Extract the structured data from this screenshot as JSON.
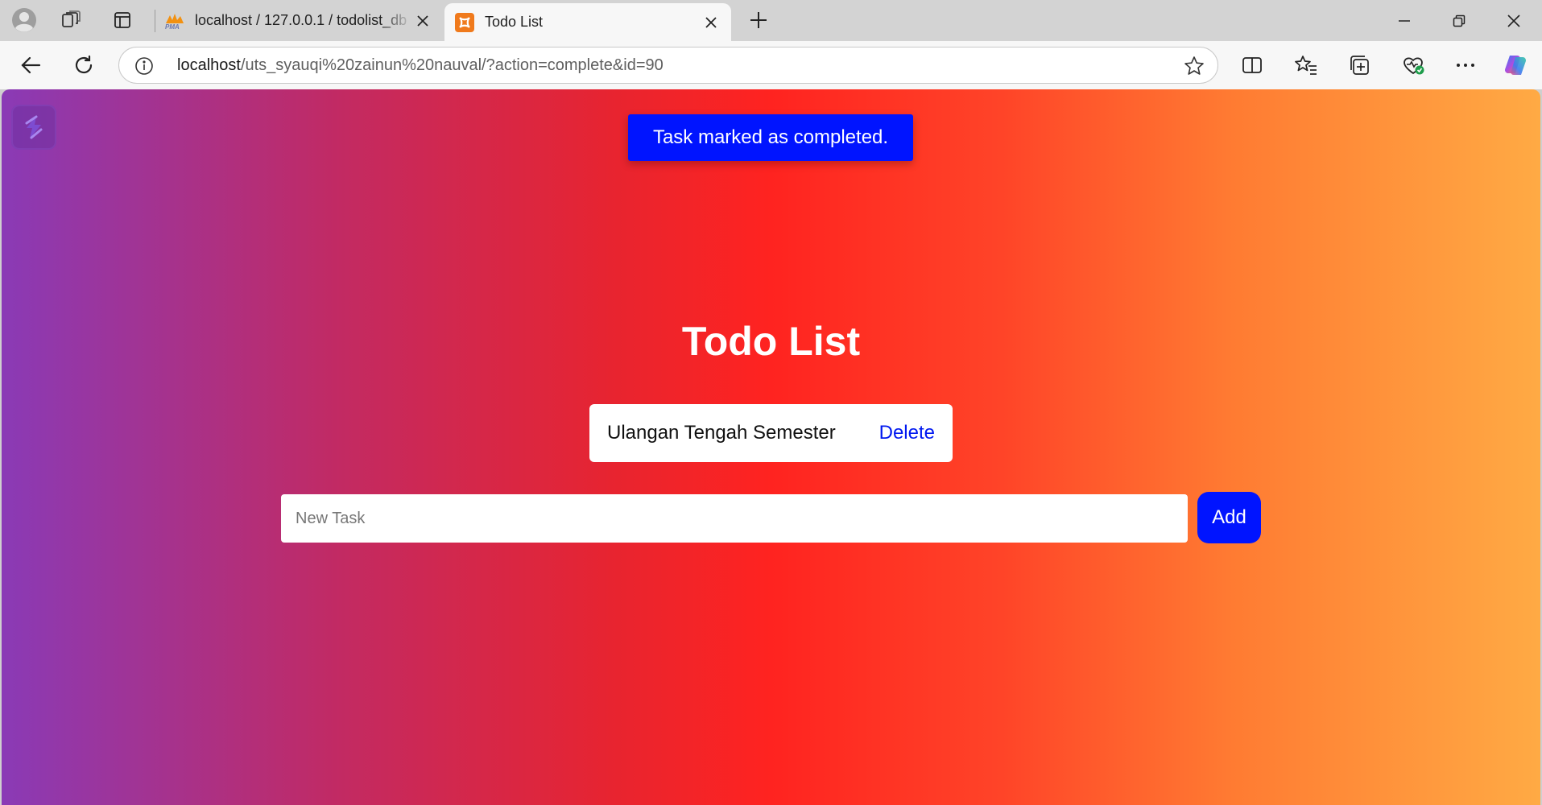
{
  "browser": {
    "tabs": [
      {
        "title": "localhost / 127.0.0.1 / todolist_db",
        "favicon": "phpmyadmin-icon",
        "active": false
      },
      {
        "title": "Todo List",
        "favicon": "xampp-icon",
        "active": true
      }
    ],
    "address": {
      "host": "localhost",
      "path": "/uts_syauqi%20zainun%20nauval/?action=complete&id=90"
    }
  },
  "page": {
    "flash_message": "Task marked as completed.",
    "title": "Todo List",
    "tasks": [
      {
        "text": "Ulangan Tengah Semester",
        "delete_label": "Delete"
      }
    ],
    "new_task_placeholder": "New Task",
    "add_label": "Add"
  },
  "colors": {
    "accent": "#0014ff",
    "gradient": [
      "#8a3ab6",
      "#ff2320",
      "#ffaa44"
    ]
  }
}
